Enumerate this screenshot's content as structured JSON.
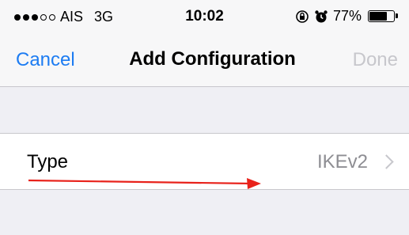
{
  "status_bar": {
    "carrier": "AIS",
    "network": "3G",
    "time": "10:02",
    "battery_percent": "77%",
    "battery_level": 0.77,
    "signal_bars_filled": 3,
    "signal_bars_total": 5,
    "icons": [
      "rotation-lock-icon",
      "alarm-icon",
      "battery-icon"
    ]
  },
  "nav_bar": {
    "cancel_label": "Cancel",
    "title": "Add Configuration",
    "done_label": "Done"
  },
  "settings": {
    "type_label": "Type",
    "type_value": "IKEv2"
  },
  "colors": {
    "accent": "#1d7cf2",
    "disabled": "#c7c7cc",
    "annotation_arrow": "#e8221b",
    "background": "#efeff4"
  }
}
